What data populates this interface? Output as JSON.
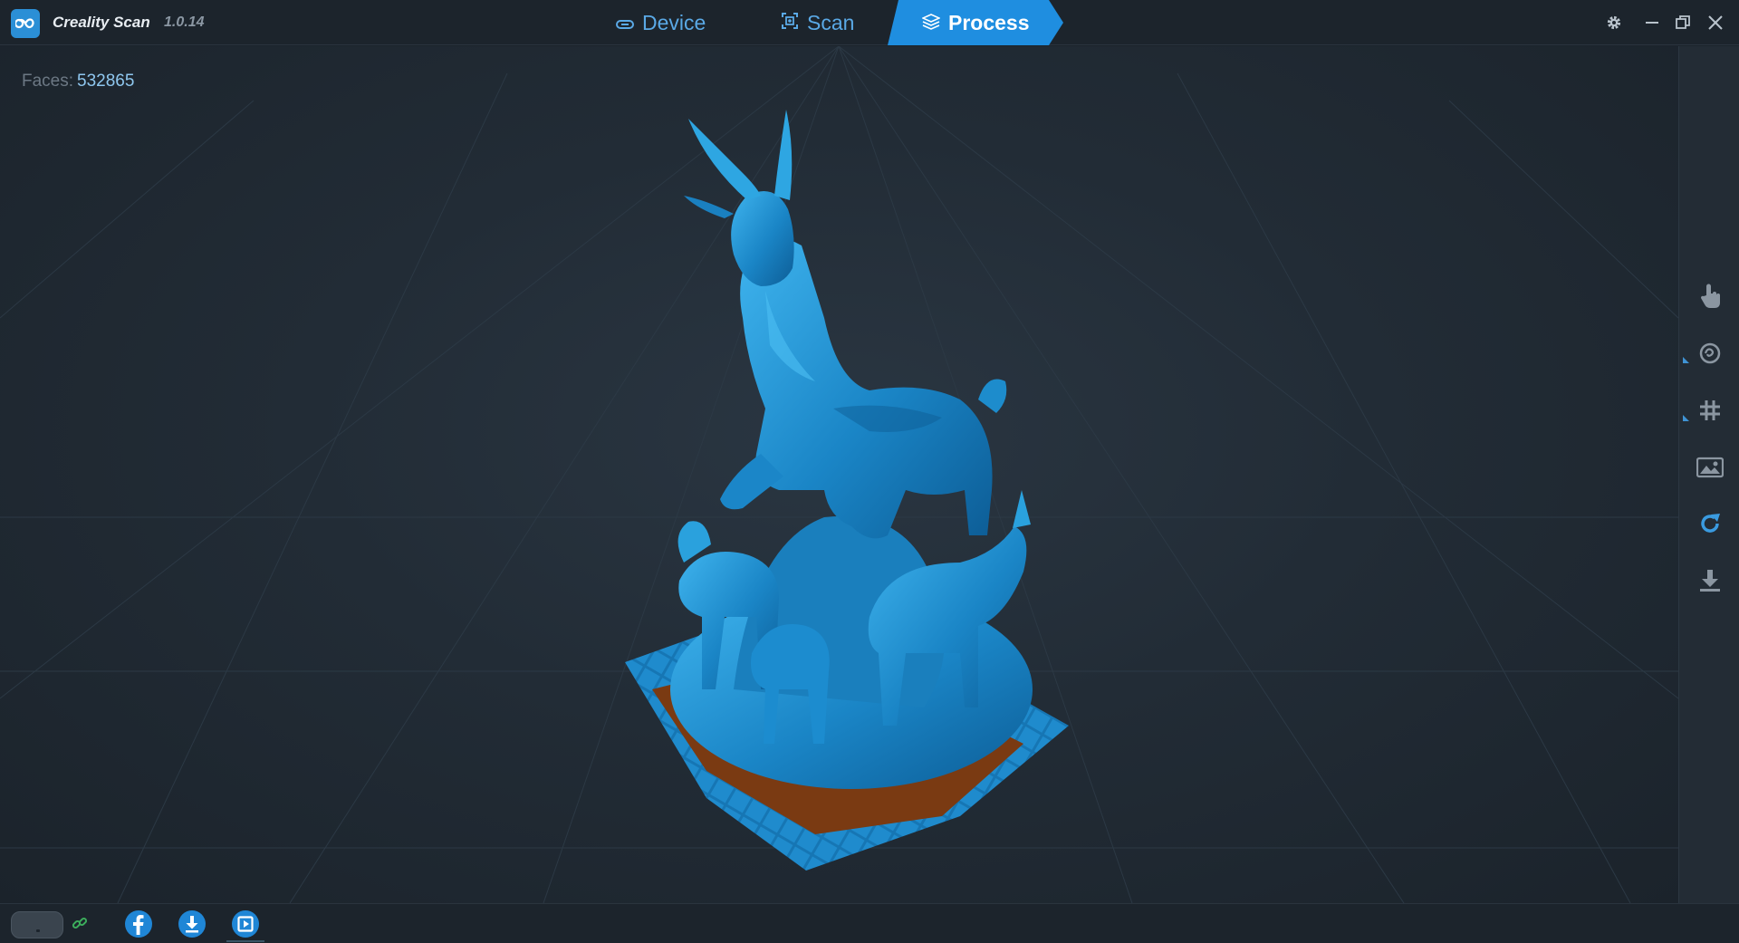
{
  "app": {
    "name": "Creality Scan",
    "version": "1.0.14"
  },
  "nav": {
    "tabs": [
      {
        "id": "device",
        "label": "Device",
        "icon": "device-icon",
        "active": false
      },
      {
        "id": "scan",
        "label": "Scan",
        "icon": "scan-icon",
        "active": false
      },
      {
        "id": "process",
        "label": "Process",
        "icon": "layers-icon",
        "active": true
      }
    ]
  },
  "window_controls": [
    "gear-icon",
    "minimize-icon",
    "restore-icon",
    "close-icon"
  ],
  "viewport": {
    "faces_label": "Faces:",
    "faces_value": "532865",
    "model": "scanned-goat-sculpture-mesh"
  },
  "right_toolbar": {
    "tools": [
      "hand-select-icon",
      "smooth-icon",
      "grid-icon",
      "texture-image-icon",
      "rotate-icon",
      "export-icon"
    ]
  },
  "bottom_bar": {
    "items": [
      "device-connection-icon",
      "link-icon",
      "facebook-icon",
      "download-icon",
      "video-icon"
    ]
  },
  "colors": {
    "accent": "#2b8fd6",
    "active_tab": "#1f8ee0",
    "model_blue": "#1f86c4",
    "model_base": "#7a3a12",
    "background": "#1b232b"
  }
}
